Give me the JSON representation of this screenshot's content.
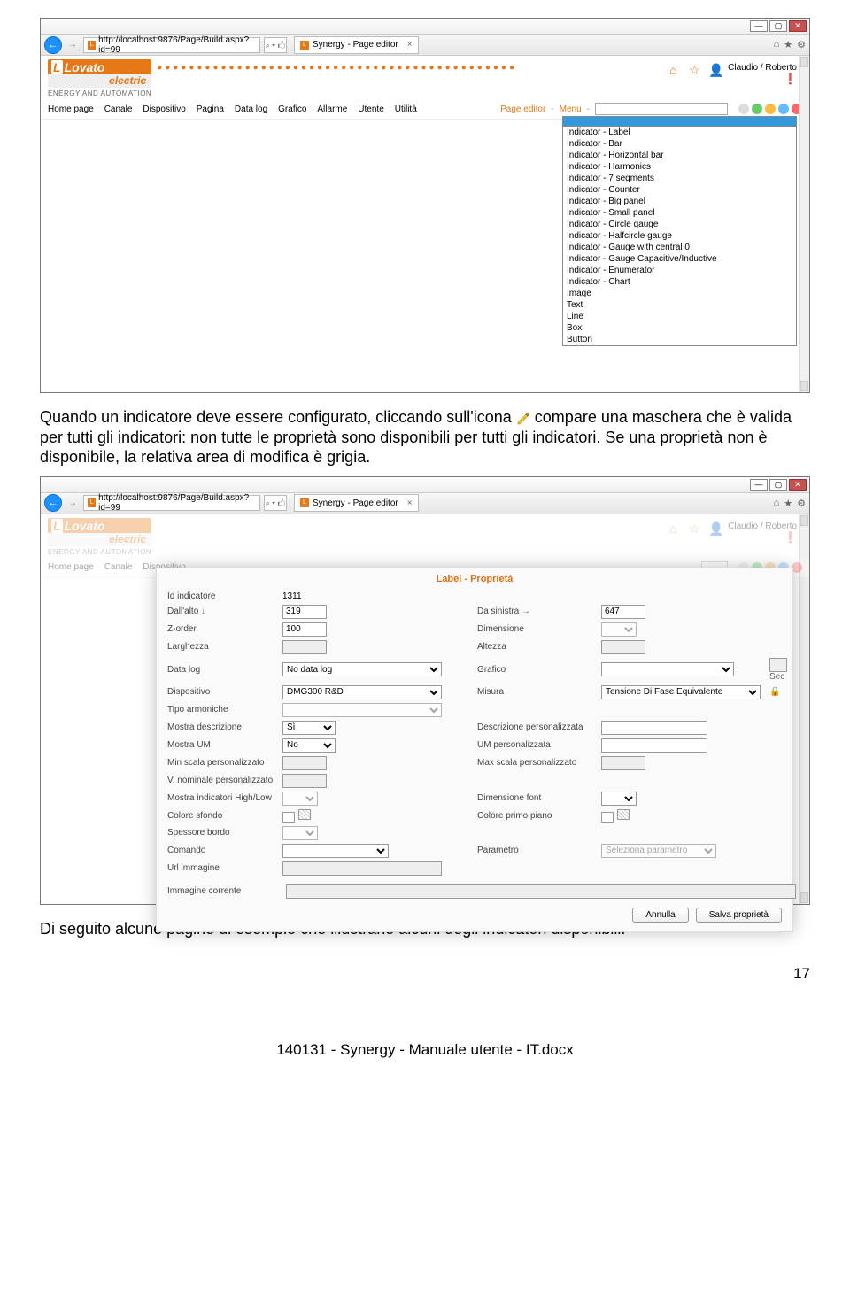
{
  "browser": {
    "url": "http://localhost:9876/Page/Build.aspx?id=99",
    "search_hint": "⌕ ▾ 🖒",
    "tab_title": "Synergy - Page editor"
  },
  "app": {
    "logo_top_pre": "L",
    "logo_top": "Lovato",
    "logo_bot": "electric",
    "logo_sub": "ENERGY AND AUTOMATION",
    "user": "Claudio / Roberto",
    "menu": [
      "Home page",
      "Canale",
      "Dispositivo",
      "Pagina",
      "Data log",
      "Grafico",
      "Allarme",
      "Utente",
      "Utilità"
    ],
    "page_editor": "Page editor",
    "menu_label": "Menu"
  },
  "dropdown": [
    "Indicator - Label",
    "Indicator - Bar",
    "Indicator - Horizontal bar",
    "Indicator - Harmonics",
    "Indicator - 7 segments",
    "Indicator - Counter",
    "Indicator - Big panel",
    "Indicator - Small panel",
    "Indicator - Circle gauge",
    "Indicator - Halfcircle gauge",
    "Indicator - Gauge with central 0",
    "Indicator - Gauge Capacitive/Inductive",
    "Indicator - Enumerator",
    "Indicator - Chart",
    "Image",
    "Text",
    "Line",
    "Box",
    "Button"
  ],
  "para1a": "Quando un indicatore deve essere configurato, cliccando sull'icona ",
  "para1b": " compare una maschera che è valida per tutti gli indicatori: non tutte le proprietà sono disponibili per tutti gli indicatori. Se una proprietà non è disponibile, la relativa area di modifica è grigia.",
  "prop": {
    "title": "Label - Proprietà",
    "id_label": "Id indicatore",
    "id_value": "1311",
    "dallalto": "Dall'alto",
    "dallalto_v": "319",
    "dasinistra": "Da sinistra",
    "dasinistra_v": "647",
    "zorder": "Z-order",
    "zorder_v": "100",
    "dimensione": "Dimensione",
    "larghezza": "Larghezza",
    "altezza": "Altezza",
    "datalog": "Data log",
    "datalog_v": "No data log",
    "grafico": "Grafico",
    "sec": "Sec",
    "dispositivo": "Dispositivo",
    "dispositivo_v": "DMG300 R&D",
    "misura": "Misura",
    "misura_v": "Tensione Di Fase Equivalente",
    "tipoarm": "Tipo armoniche",
    "mostradesc": "Mostra descrizione",
    "mostradesc_v": "Sì",
    "descpers": "Descrizione personalizzata",
    "mostraum": "Mostra UM",
    "mostraum_v": "No",
    "umpers": "UM personalizzata",
    "minscala": "Min scala personalizzato",
    "maxscala": "Max scala personalizzato",
    "vnom": "V. nominale personalizzato",
    "mostrahl": "Mostra indicatori High/Low",
    "dimfont": "Dimensione font",
    "colsfondo": "Colore sfondo",
    "colpp": "Colore primo piano",
    "spessbordo": "Spessore bordo",
    "comando": "Comando",
    "parametro": "Parametro",
    "param_ph": "Seleziona parametro",
    "urlimg": "Url immagine",
    "imgcorr": "Immagine corrente",
    "annulla": "Annulla",
    "salva": "Salva proprietà"
  },
  "para2": "Di seguito alcune pagine di esempio che illustrano alcuni degli indicatori disponibili.",
  "footer": "140131 - Synergy - Manuale utente - IT.docx",
  "page_num": "17"
}
